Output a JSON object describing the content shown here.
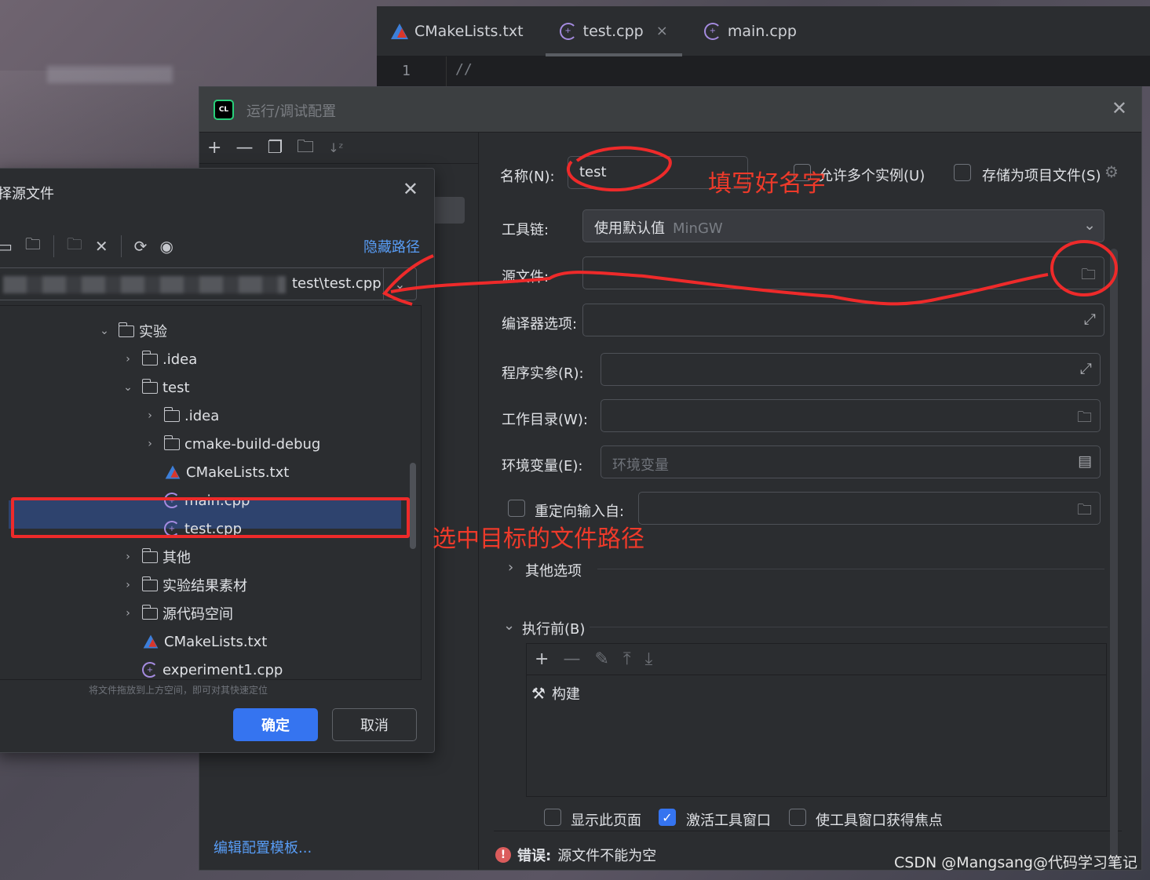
{
  "editor": {
    "tabs": [
      {
        "label": "CMakeLists.txt"
      },
      {
        "label": "test.cpp",
        "close": "×"
      },
      {
        "label": "main.cpp"
      }
    ],
    "line_number": "1",
    "code": "//"
  },
  "config_dialog": {
    "title": "运行/调试配置",
    "close": "✕",
    "edit_templates": "编辑配置模板...",
    "name_label": "名称(N):",
    "name_value": "test",
    "allow_multiple": "允许多个实例(U)",
    "store_as_project": "存储为项目文件(S)",
    "toolchain_label": "工具链:",
    "toolchain_value": "使用默认值",
    "toolchain_detail": "MinGW",
    "source_label": "源文件:",
    "compiler_label": "编译器选项:",
    "args_label": "程序实参(R):",
    "workdir_label": "工作目录(W):",
    "env_label": "环境变量(E):",
    "env_placeholder": "环境变量",
    "redirect_label": "重定向输入自:",
    "other_options": "其他选项",
    "before_launch": "执行前(B)",
    "build_task": "构建",
    "show_page": "显示此页面",
    "activate_window": "激活工具窗口",
    "focus_window": "使工具窗口获得焦点",
    "error_prefix": "错误:",
    "error_text": "源文件不能为空"
  },
  "file_chooser": {
    "title": "择源文件",
    "close": "✕",
    "hide_path": "隐藏路径",
    "path_tail": "test\\test.cpp",
    "hint": "将文件拖放到上方空间，即可对其快速定位",
    "ok": "确定",
    "cancel": "取消",
    "tree": [
      {
        "label": "实验",
        "type": "folder",
        "chev": "⌄"
      },
      {
        "label": ".idea",
        "type": "folder",
        "chev": "›"
      },
      {
        "label": "test",
        "type": "folder",
        "chev": "⌄"
      },
      {
        "label": ".idea",
        "type": "folder",
        "chev": "›"
      },
      {
        "label": "cmake-build-debug",
        "type": "folder",
        "chev": "›"
      },
      {
        "label": "CMakeLists.txt",
        "type": "cmake",
        "chev": ""
      },
      {
        "label": "main.cpp",
        "type": "cpp",
        "chev": ""
      },
      {
        "label": "test.cpp",
        "type": "cpp",
        "chev": ""
      },
      {
        "label": "其他",
        "type": "folder",
        "chev": "›"
      },
      {
        "label": "实验结果素材",
        "type": "folder",
        "chev": "›"
      },
      {
        "label": "源代码空间",
        "type": "folder",
        "chev": "›"
      },
      {
        "label": "CMakeLists.txt",
        "type": "cmake",
        "chev": ""
      },
      {
        "label": "experiment1.cpp",
        "type": "cpp",
        "chev": ""
      }
    ]
  },
  "annotations": {
    "fill_name": "填写好名字",
    "select_path": "选中目标的文件路径"
  },
  "watermark": "CSDN @Mangsang@代码学习笔记"
}
